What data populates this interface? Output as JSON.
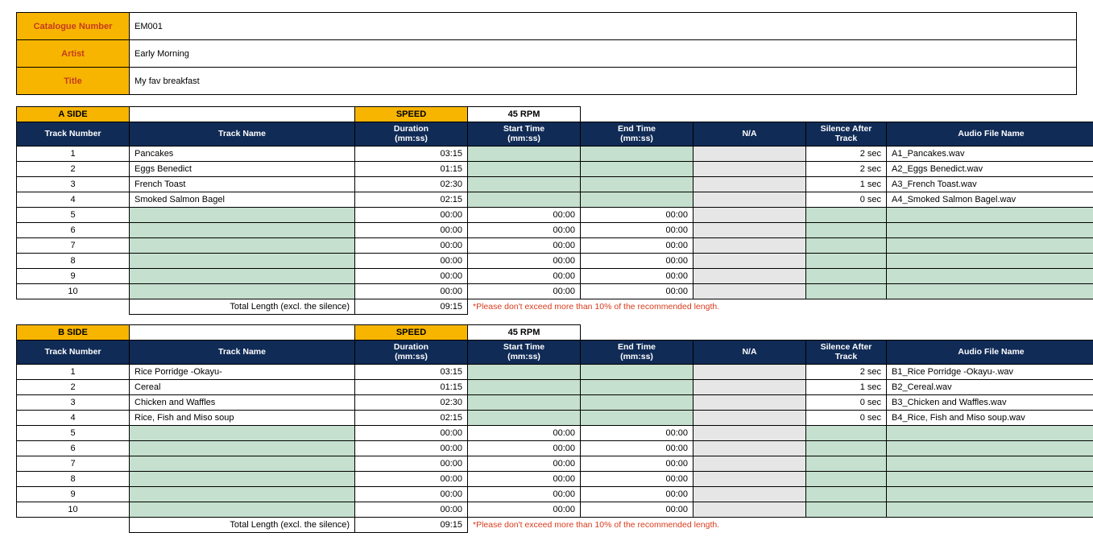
{
  "info": {
    "labels": {
      "catalogue": "Catalogue  Number",
      "artist": "Artist",
      "title": "Title"
    },
    "catalogue": "EM001",
    "artist": "Early Morning",
    "title": "My fav breakfast"
  },
  "headers": {
    "track_number": "Track Number",
    "track_name": "Track Name",
    "duration": "Duration (mm:ss)",
    "start": "Start Time (mm:ss)",
    "end": "End Time (mm:ss)",
    "na": "N/A",
    "silence": "Silence After Track",
    "file": "Audio File Name",
    "speed_label": "SPEED",
    "speed_value": "45 RPM",
    "total_label": "Total Length (excl. the silence)",
    "warning": "*Please don't exceed more than 10% of the recommended length."
  },
  "sides": [
    {
      "side_label": "A SIDE",
      "total": "09:15",
      "rows": [
        {
          "num": "1",
          "name": "Pancakes",
          "dur": "03:15",
          "start": "",
          "end": "",
          "silence": "2 sec",
          "file": "A1_Pancakes.wav"
        },
        {
          "num": "2",
          "name": "Eggs Benedict",
          "dur": "01:15",
          "start": "",
          "end": "",
          "silence": "2 sec",
          "file": "A2_Eggs Benedict.wav"
        },
        {
          "num": "3",
          "name": "French Toast",
          "dur": "02:30",
          "start": "",
          "end": "",
          "silence": "1 sec",
          "file": "A3_French Toast.wav"
        },
        {
          "num": "4",
          "name": "Smoked Salmon Bagel",
          "dur": "02:15",
          "start": "",
          "end": "",
          "silence": "0 sec",
          "file": "A4_Smoked Salmon Bagel.wav"
        },
        {
          "num": "5",
          "name": "",
          "dur": "00:00",
          "start": "00:00",
          "end": "00:00",
          "silence": "",
          "file": ""
        },
        {
          "num": "6",
          "name": "",
          "dur": "00:00",
          "start": "00:00",
          "end": "00:00",
          "silence": "",
          "file": ""
        },
        {
          "num": "7",
          "name": "",
          "dur": "00:00",
          "start": "00:00",
          "end": "00:00",
          "silence": "",
          "file": ""
        },
        {
          "num": "8",
          "name": "",
          "dur": "00:00",
          "start": "00:00",
          "end": "00:00",
          "silence": "",
          "file": ""
        },
        {
          "num": "9",
          "name": "",
          "dur": "00:00",
          "start": "00:00",
          "end": "00:00",
          "silence": "",
          "file": ""
        },
        {
          "num": "10",
          "name": "",
          "dur": "00:00",
          "start": "00:00",
          "end": "00:00",
          "silence": "",
          "file": ""
        }
      ]
    },
    {
      "side_label": "B SIDE",
      "total": "09:15",
      "rows": [
        {
          "num": "1",
          "name": "Rice Porridge -Okayu-",
          "dur": "03:15",
          "start": "",
          "end": "",
          "silence": "2 sec",
          "file": "B1_Rice Porridge -Okayu-.wav"
        },
        {
          "num": "2",
          "name": "Cereal",
          "dur": "01:15",
          "start": "",
          "end": "",
          "silence": "1 sec",
          "file": "B2_Cereal.wav"
        },
        {
          "num": "3",
          "name": "Chicken and Waffles",
          "dur": "02:30",
          "start": "",
          "end": "",
          "silence": "0 sec",
          "file": "B3_Chicken and Waffles.wav"
        },
        {
          "num": "4",
          "name": "Rice, Fish and Miso soup",
          "dur": "02:15",
          "start": "",
          "end": "",
          "silence": "0 sec",
          "file": "B4_Rice, Fish and Miso soup.wav"
        },
        {
          "num": "5",
          "name": "",
          "dur": "00:00",
          "start": "00:00",
          "end": "00:00",
          "silence": "",
          "file": ""
        },
        {
          "num": "6",
          "name": "",
          "dur": "00:00",
          "start": "00:00",
          "end": "00:00",
          "silence": "",
          "file": ""
        },
        {
          "num": "7",
          "name": "",
          "dur": "00:00",
          "start": "00:00",
          "end": "00:00",
          "silence": "",
          "file": ""
        },
        {
          "num": "8",
          "name": "",
          "dur": "00:00",
          "start": "00:00",
          "end": "00:00",
          "silence": "",
          "file": ""
        },
        {
          "num": "9",
          "name": "",
          "dur": "00:00",
          "start": "00:00",
          "end": "00:00",
          "silence": "",
          "file": ""
        },
        {
          "num": "10",
          "name": "",
          "dur": "00:00",
          "start": "00:00",
          "end": "00:00",
          "silence": "",
          "file": ""
        }
      ]
    }
  ]
}
